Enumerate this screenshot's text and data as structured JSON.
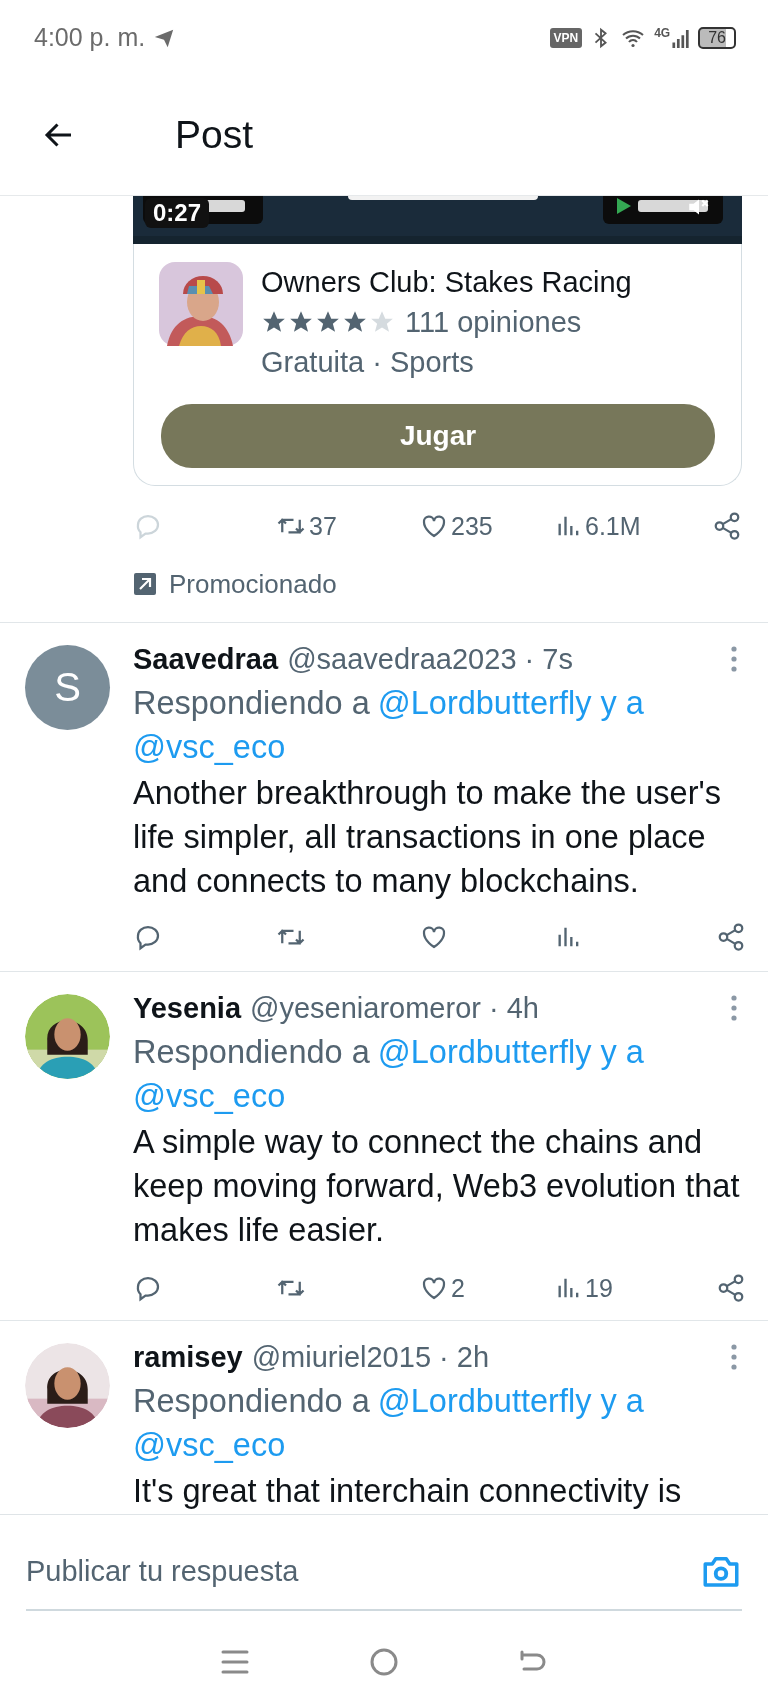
{
  "status_bar": {
    "time": "4:00 p. m.",
    "vpn": "VPN",
    "network": "4G",
    "battery": "76"
  },
  "header": {
    "title": "Post"
  },
  "ad": {
    "media": {
      "kind": "picture",
      "duration": "0:27"
    },
    "app": {
      "name": "Owners Club: Stakes Racing",
      "stars": 4,
      "reviews": "111 opiniones",
      "meta": "Gratuita · Sports"
    },
    "button": "Jugar",
    "stats": {
      "reply_disabled": true,
      "retweets": "37",
      "likes": "235",
      "views": "6.1M"
    },
    "promoted": "Promocionado"
  },
  "replies": [
    {
      "name": "Saavedraa",
      "handle_time": "@saavedraa2023 · 7s",
      "avatar": {
        "kind": "letter",
        "letter": "S"
      },
      "replying": {
        "prefix": "Respondiendo a",
        "mentions": [
          "@Lordbutterfly y a",
          "@vsc_eco"
        ]
      },
      "text": "Another breakthrough to make the user's life simpler, all transactions in one place and connects to many blockchains.",
      "stats": {
        "reply_disabled": false
      }
    },
    {
      "name": "Yesenia",
      "handle_time": "@yeseniaromeror · 4h",
      "replying": {
        "prefix": "Respondiendo a",
        "mentions": [
          "@Lordbutterfly y a",
          "@vsc_eco"
        ]
      },
      "text": "A simple way to connect the chains and keep moving forward, Web3 evolution that makes life easier.",
      "stats": {
        "reply_disabled": false,
        "likes": "2",
        "views": "19"
      }
    },
    {
      "name": "ramisey",
      "handle_time": "@miuriel2015 · 2h",
      "replying": {
        "prefix": "Respondiendo a",
        "mentions": [
          "@Lordbutterfly y a",
          "@vsc_eco"
        ]
      },
      "text": "It's great that interchain connectivity is"
    }
  ],
  "reply_bar": {
    "placeholder": "Publicar tu respuesta"
  }
}
